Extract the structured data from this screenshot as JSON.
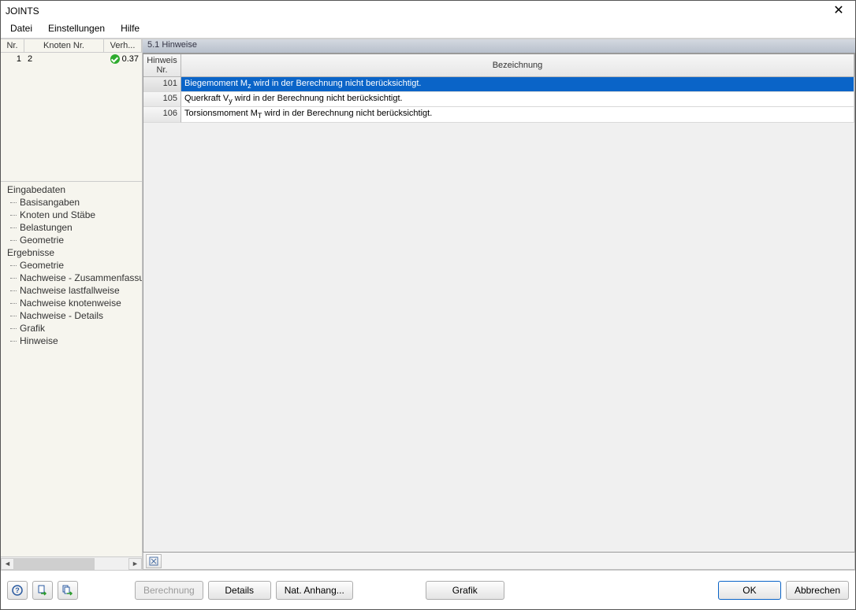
{
  "window": {
    "title": "JOINTS"
  },
  "menu": {
    "file": "Datei",
    "settings": "Einstellungen",
    "help": "Hilfe"
  },
  "topGrid": {
    "headers": {
      "nr": "Nr.",
      "knoten": "Knoten Nr.",
      "verh": "Verh..."
    },
    "rows": [
      {
        "nr": "1",
        "knoten": "2",
        "verh": "0.37"
      }
    ]
  },
  "tree": {
    "group1": "Eingabedaten",
    "g1_items": {
      "a": "Basisangaben",
      "b": "Knoten und Stäbe",
      "c": "Belastungen",
      "d": "Geometrie"
    },
    "group2": "Ergebnisse",
    "g2_items": {
      "a": "Geometrie",
      "b": "Nachweise - Zusammenfassung",
      "c": "Nachweise lastfallweise",
      "d": "Nachweise knotenweise",
      "e": "Nachweise - Details",
      "f": "Grafik",
      "g": "Hinweise"
    }
  },
  "panel": {
    "title": "5.1 Hinweise"
  },
  "grid": {
    "headers": {
      "nr_line1": "Hinweis",
      "nr_line2": "Nr.",
      "desc": "Bezeichnung"
    },
    "rows": [
      {
        "nr": "101",
        "desc_pre": "Biegemoment M",
        "desc_sub": "z",
        "desc_post": " wird in der Berechnung nicht berücksichtigt."
      },
      {
        "nr": "105",
        "desc_pre": "Querkraft V",
        "desc_sub": "y",
        "desc_post": " wird in der Berechnung nicht berücksichtigt."
      },
      {
        "nr": "106",
        "desc_pre": "Torsionsmoment M",
        "desc_sub": "T",
        "desc_post": " wird in der Berechnung nicht berücksichtigt."
      }
    ]
  },
  "footer": {
    "berechnung": "Berechnung",
    "details": "Details",
    "nat_anhang": "Nat. Anhang...",
    "grafik": "Grafik",
    "ok": "OK",
    "abbrechen": "Abbrechen"
  }
}
